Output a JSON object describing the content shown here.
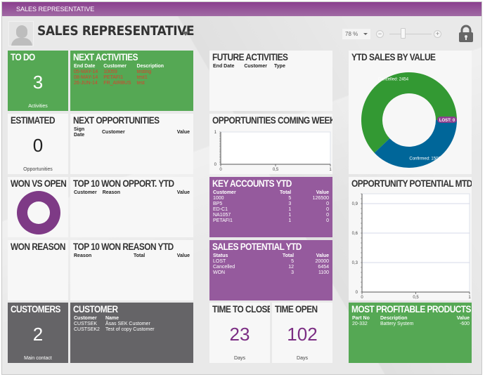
{
  "window": {
    "title": "SALES REPRESENTATIVE"
  },
  "header": {
    "title": "SALES REPRESENTATIVE",
    "zoom_value": "78 %",
    "zoom_minus": "−",
    "zoom_plus": "+",
    "zoom_slider_fraction": 0.35,
    "icons": [
      "avatar-placeholder",
      "chevron-down-icon",
      "lock-icon"
    ]
  },
  "colors": {
    "green": "#55a854",
    "purple": "#955a9d",
    "gray": "#656467",
    "title_bar": "#8a3f8e",
    "donut_green": "#339933",
    "donut_blue": "#006699",
    "lost_badge": "#8a3f8e"
  },
  "tiles": {
    "todo": {
      "title": "TO DO",
      "value": "3",
      "label": "Activities"
    },
    "next_activities": {
      "title": "NEXT ACTIVITIES",
      "columns": [
        "End Date",
        "Customer",
        "Description"
      ],
      "rows": [
        [
          "05-MAY-14",
          "10059",
          "testing"
        ],
        [
          "08-MAY-14",
          "PETAFI1",
          "test1"
        ],
        [
          "26-JUN-14",
          "FR_AIRBUS",
          "test"
        ]
      ]
    },
    "future_activities": {
      "title": "FUTURE ACTIVITIES",
      "columns": [
        "End Date",
        "Customer",
        "Type"
      ]
    },
    "estimated": {
      "title": "ESTIMATED",
      "value": "0",
      "label": "Opportunities"
    },
    "next_opportunities": {
      "title": "NEXT OPPORTUNITIES",
      "columns": [
        "Sign Date",
        "Customer",
        "Value"
      ]
    },
    "won_vs_open": {
      "title": "WON VS OPEN"
    },
    "top10_won_opport": {
      "title": "TOP 10 WON OPPORT. YTD",
      "columns": [
        "Customer",
        "Reason",
        "Value"
      ]
    },
    "key_accounts": {
      "title": "KEY ACCOUNTS YTD",
      "columns": [
        "Customer",
        "Total",
        "Value"
      ],
      "rows": [
        [
          "1000",
          "5",
          "126500"
        ],
        [
          "BP5",
          "3",
          "0"
        ],
        [
          "ED-C1",
          "1",
          "0"
        ],
        [
          "NA1057",
          "1",
          "0"
        ],
        [
          "PETAFI1",
          "1",
          "0"
        ]
      ]
    },
    "won_reason": {
      "title": "WON REASON"
    },
    "top10_won_reason": {
      "title": "TOP 10 WON REASON YTD",
      "columns": [
        "Reason",
        "Total",
        "Value"
      ]
    },
    "sales_potential": {
      "title": "SALES POTENTIAL YTD",
      "columns": [
        "Status",
        "Total",
        "Value"
      ],
      "rows": [
        [
          "LOST",
          "5",
          "20000"
        ],
        [
          "Cancelled",
          "12",
          "6454"
        ],
        [
          "WON",
          "3",
          "1100"
        ]
      ]
    },
    "customers": {
      "title": "CUSTOMERS",
      "value": "2",
      "label": "Main contact"
    },
    "customer": {
      "title": "CUSTOMER",
      "columns": [
        "Customer",
        "Name"
      ],
      "rows": [
        [
          "CUSTSEK",
          "Åsas SEK Customer"
        ],
        [
          "CUSTSEK2",
          "Test of copy Customer"
        ]
      ]
    },
    "time_to_close": {
      "title": "TIME TO CLOSE",
      "value": "23",
      "label": "Days"
    },
    "time_open": {
      "title": "TIME OPEN",
      "value": "102",
      "label": "Days"
    },
    "most_profitable": {
      "title": "MOST PROFITABLE PRODUCTS",
      "columns": [
        "Part No",
        "Description",
        "Value"
      ],
      "rows": [
        [
          "20-332",
          "Battery System",
          "-600"
        ]
      ]
    },
    "opportunities_coming_week": {
      "title": "OPPORTUNITIES COMING WEEK"
    },
    "opportunity_potential_mtd": {
      "title": "OPPORTUNITY POTENTIAL MTD"
    },
    "ytd_sales_by_value": {
      "title": "YTD SALES BY VALUE"
    }
  },
  "chart_data": [
    {
      "id": "ytd_sales_by_value",
      "type": "pie",
      "title": "YTD SALES BY VALUE",
      "donut": true,
      "slices": [
        {
          "label": "Cancelled",
          "value": 2454,
          "display": "Cancelled: 2454",
          "color": "#339933"
        },
        {
          "label": "Confirmed",
          "value": 1500,
          "display": "Confirmed: 1500",
          "color": "#006699"
        },
        {
          "label": "LOST",
          "value": 0,
          "display": "LOST: 0",
          "color": "#8a3f8e"
        }
      ]
    },
    {
      "id": "opportunities_coming_week",
      "type": "line",
      "title": "OPPORTUNITIES COMING WEEK",
      "series": [],
      "xlim": [
        0,
        1
      ],
      "ylim": [
        0,
        1
      ],
      "xticks": [
        "0",
        "0,5",
        "1"
      ],
      "yticks": [
        "0",
        "1"
      ],
      "grid": false
    },
    {
      "id": "opportunity_potential_mtd",
      "type": "line",
      "title": "OPPORTUNITY POTENTIAL MTD",
      "series": [],
      "xlim": [
        0,
        1
      ],
      "ylim": [
        0,
        1
      ],
      "xticks": [
        "0",
        "0,5",
        "1"
      ],
      "yticks": [
        "0",
        "0,3",
        "0,6",
        "0,9"
      ],
      "grid": true
    },
    {
      "id": "won_vs_open",
      "type": "pie",
      "title": "WON VS OPEN",
      "donut": true,
      "slices": [
        {
          "label": "WON",
          "value": 1,
          "color": "#7e3a86"
        }
      ]
    }
  ]
}
